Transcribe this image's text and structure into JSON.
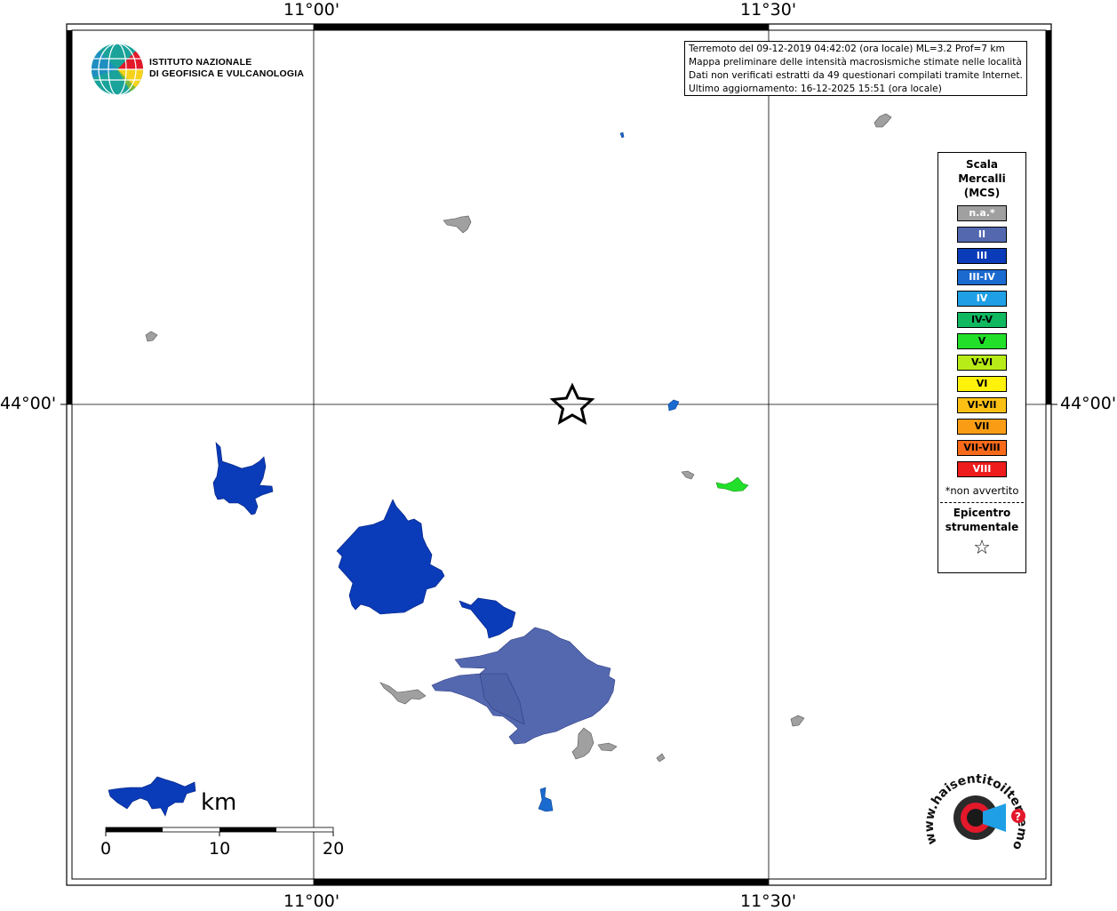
{
  "coordinates": {
    "lon_labels": [
      "11°00'",
      "11°30'"
    ],
    "lat_label": "44°00'"
  },
  "info_box": {
    "line1": "Terremoto del 09-12-2019 04:42:02 (ora locale) ML=3.2 Prof=7 km",
    "line2": "Mappa preliminare delle intensità macrosismiche stimate nelle località",
    "line3": "Dati non verificati estratti da 49 questionari compilati tramite Internet.",
    "line4": "Ultimo aggiornamento: 16-12-2025 15:51 (ora locale)"
  },
  "institute": {
    "name_line1": "ISTITUTO NAZIONALE",
    "name_line2": "DI GEOFISICA E VULCANOLOGIA"
  },
  "legend": {
    "title_line1": "Scala",
    "title_line2": "Mercalli",
    "title_line3": "(MCS)",
    "items": [
      {
        "label": "n.a.*",
        "color": "#a0a0a0",
        "text_color": "#ffffff"
      },
      {
        "label": "II",
        "color": "#5468b0",
        "text_color": "#ffffff"
      },
      {
        "label": "III",
        "color": "#0a3bb8",
        "text_color": "#ffffff"
      },
      {
        "label": "III-IV",
        "color": "#1a6ad0",
        "text_color": "#ffffff"
      },
      {
        "label": "IV",
        "color": "#1fa0e6",
        "text_color": "#ffffff"
      },
      {
        "label": "IV-V",
        "color": "#10b860",
        "text_color": "#000000"
      },
      {
        "label": "V",
        "color": "#22e02a",
        "text_color": "#000000"
      },
      {
        "label": "V-VI",
        "color": "#b8ec18",
        "text_color": "#000000"
      },
      {
        "label": "VI",
        "color": "#fff20a",
        "text_color": "#000000"
      },
      {
        "label": "VI-VII",
        "color": "#fcc014",
        "text_color": "#000000"
      },
      {
        "label": "VII",
        "color": "#fb9d14",
        "text_color": "#000000"
      },
      {
        "label": "VII-VIII",
        "color": "#f86a1a",
        "text_color": "#000000"
      },
      {
        "label": "VIII",
        "color": "#ee1c1c",
        "text_color": "#ffffff"
      }
    ],
    "note": "*non avvertito",
    "epicenter_line1": "Epicentro",
    "epicenter_line2": "strumentale",
    "epicenter_symbol": "☆"
  },
  "scale_bar": {
    "unit": "km",
    "ticks": [
      "0",
      "10",
      "20"
    ]
  },
  "watermark": {
    "text": "www.haisentitoilterremoto.it"
  },
  "colors": {
    "na": "#a0a0a0",
    "II": "#5468b0",
    "III": "#0a3bb8",
    "III_IV": "#1a6ad0",
    "V": "#22e02a"
  }
}
